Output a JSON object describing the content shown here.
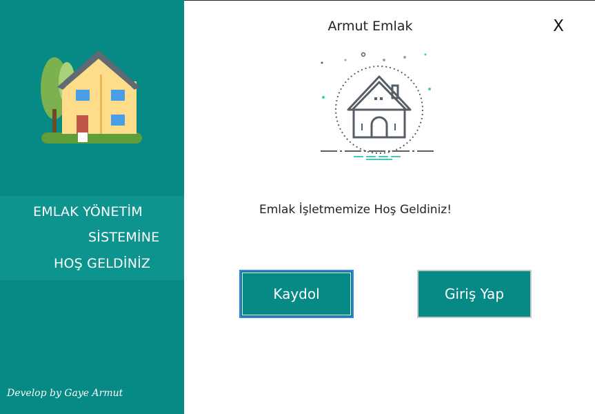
{
  "sidebar": {
    "welcome_line1": "EMLAK YÖNETİM",
    "welcome_line2": "SİSTEMİNE",
    "welcome_line3": "HOŞ GELDİNİZ",
    "credit": "Develop by Gaye Armut",
    "logo_icon": "house-with-trees-icon"
  },
  "window": {
    "title": "Armut Emlak",
    "close_label": "X"
  },
  "main": {
    "illustration_icon": "house-outline-icon",
    "welcome_message": "Emlak İşletmemize Hoş Geldiniz!",
    "register_label": "Kaydol",
    "login_label": "Giriş Yap"
  },
  "colors": {
    "sidebar": "#078a85",
    "sidebar_band": "#0e948f",
    "button": "#078a85",
    "focus_border": "#3c7ff0"
  }
}
